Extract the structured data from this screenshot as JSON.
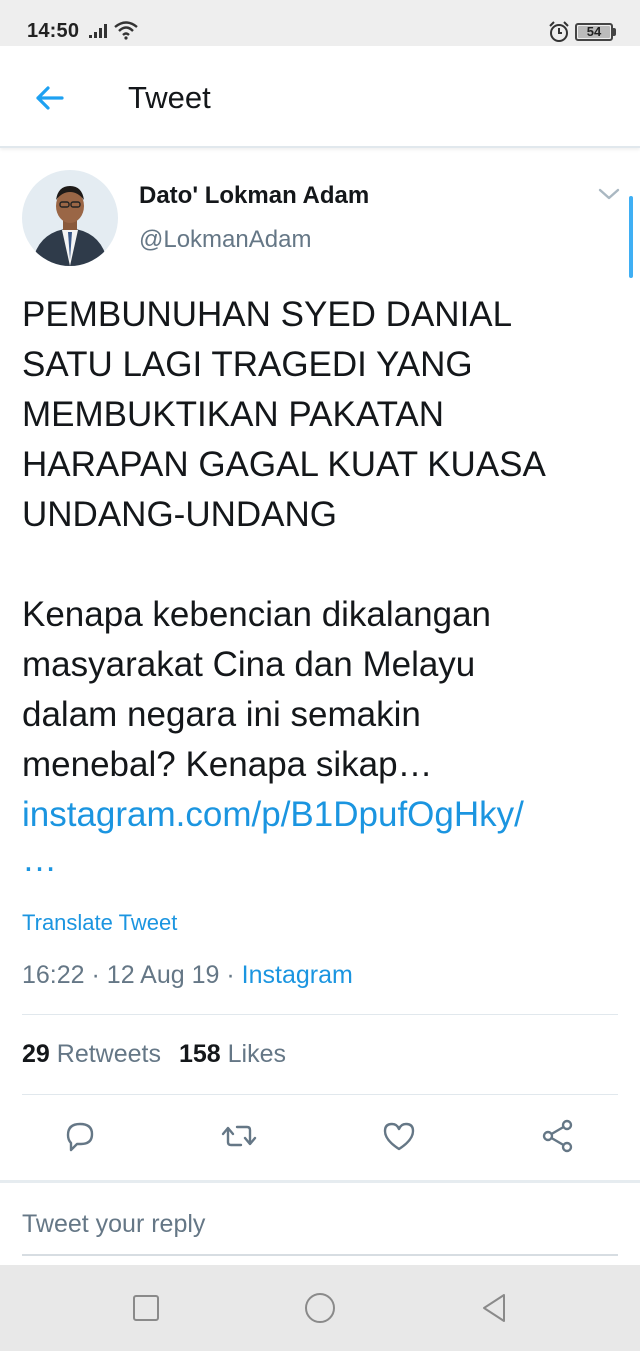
{
  "status_bar": {
    "time": "14:50",
    "battery": "54",
    "icons": [
      "signal-icon",
      "wifi-icon",
      "alarm-icon",
      "battery-icon"
    ]
  },
  "header": {
    "title": "Tweet",
    "back_icon": "arrow-left-icon"
  },
  "tweet": {
    "author_name": "Dato' Lokman Adam",
    "author_handle": "@LokmanAdam",
    "text_lines": [
      "PEMBUNUHAN SYED DANIAL",
      "SATU LAGI TRAGEDI YANG",
      "MEMBUKTIKAN PAKATAN",
      "HARAPAN GAGAL KUAT KUASA",
      "UNDANG-UNDANG",
      "",
      "Kenapa kebencian dikalangan",
      "masyarakat Cina dan Melayu",
      "dalam negara ini semakin",
      "menebal?  Kenapa sikap…"
    ],
    "link": "instagram.com/p/B1DpufOgHky/",
    "link_ellipsis": "…",
    "translate_label": "Translate Tweet",
    "time": "16:22",
    "date": "12 Aug 19",
    "separator": "·",
    "source": "Instagram",
    "retweets_count": "29",
    "retweets_label": "Retweets",
    "likes_count": "158",
    "likes_label": "Likes"
  },
  "actions": [
    "reply-icon",
    "retweet-icon",
    "like-icon",
    "share-icon"
  ],
  "reply": {
    "placeholder": "Tweet your reply"
  },
  "nav": [
    "recent-apps-icon",
    "home-icon",
    "back-icon"
  ],
  "colors": {
    "accent": "#1da1f2",
    "link": "#1b95e0",
    "text": "#14171a",
    "secondary": "#657786",
    "divider": "#e1e8ed"
  }
}
